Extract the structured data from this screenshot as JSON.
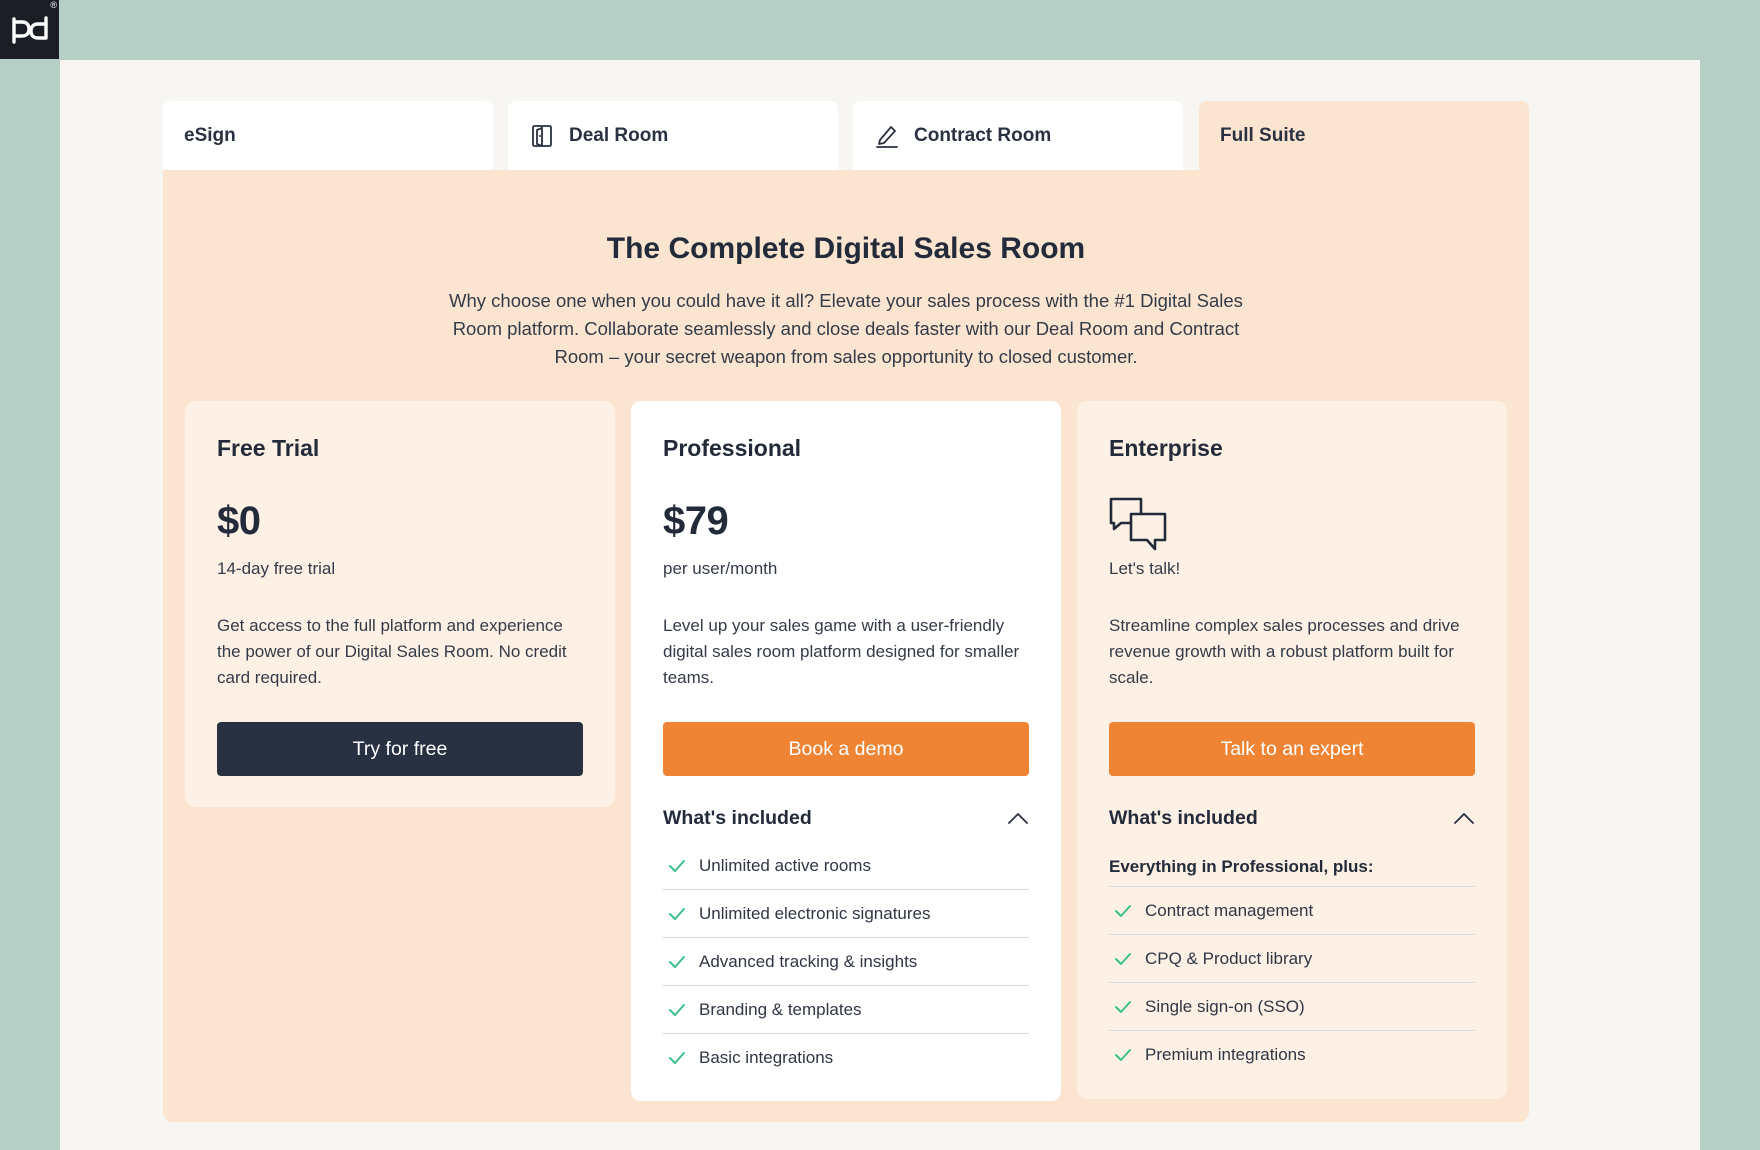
{
  "brand": {
    "logo_icon": "pandadoc-logo-icon",
    "registered_mark": "®"
  },
  "tabs": [
    {
      "label": "eSign",
      "icon": "",
      "active": false
    },
    {
      "label": "Deal Room",
      "icon": "door-icon",
      "active": false
    },
    {
      "label": "Contract Room",
      "icon": "pen-icon",
      "active": false
    },
    {
      "label": "Full Suite",
      "icon": "",
      "active": true
    }
  ],
  "hero": {
    "title": "The Complete Digital Sales Room",
    "description": "Why choose one when you could have it all? Elevate your sales process with the #1 Digital Sales Room platform. Collaborate seamlessly and close deals faster with our Deal Room and Contract Room – your secret weapon from sales opportunity to closed customer."
  },
  "plans": {
    "free": {
      "name": "Free Trial",
      "price": "$0",
      "price_sub": "14-day free trial",
      "description": "Get access to the full platform and experience the power of our Digital Sales Room. No credit card required.",
      "cta": "Try for free"
    },
    "pro": {
      "name": "Professional",
      "price": "$79",
      "price_sub": "per user/month",
      "description": "Level up your sales game with a user-friendly digital sales room platform designed for smaller teams.",
      "cta": "Book a demo",
      "included_title": "What's included",
      "features": [
        "Unlimited active rooms",
        "Unlimited electronic signatures",
        "Advanced tracking & insights",
        "Branding & templates",
        "Basic integrations"
      ]
    },
    "enterprise": {
      "name": "Enterprise",
      "icon": "chat-bubbles-icon",
      "price_sub": "Let's talk!",
      "description": "Streamline complex sales processes and drive revenue growth with a robust platform built for scale.",
      "cta": "Talk to an expert",
      "included_title": "What's included",
      "plus_line": "Everything in Professional, plus:",
      "features": [
        "Contract management",
        "CPQ & Product library",
        "Single sign-on (SSO)",
        "Premium integrations"
      ]
    }
  },
  "colors": {
    "background": "#b8cfc7",
    "panel": "#f8f6f3",
    "suite_bg": "#fbe5d0",
    "accent_orange": "#ee8434",
    "dark_button": "#273142",
    "check_green": "#3cc08e"
  }
}
